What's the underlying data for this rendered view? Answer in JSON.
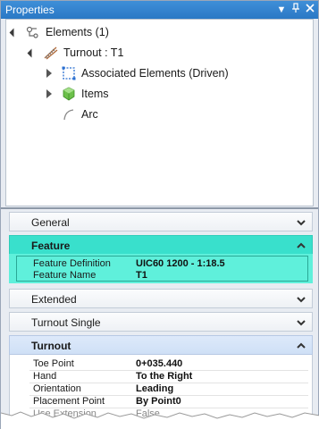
{
  "window": {
    "title": "Properties"
  },
  "titlebar_icons": [
    "dropdown-arrow-icon",
    "pin-icon",
    "close-icon"
  ],
  "tree": {
    "root_label": "Elements (1)",
    "turnout_label": "Turnout : T1",
    "children": [
      {
        "label": "Associated Elements (Driven)",
        "icon": "associated-elements-icon",
        "expandable": true
      },
      {
        "label": "Items",
        "icon": "items-cube-icon",
        "expandable": true
      },
      {
        "label": "Arc",
        "icon": "arc-icon",
        "expandable": false
      }
    ]
  },
  "sections": {
    "general": {
      "label": "General",
      "expanded": false
    },
    "feature": {
      "label": "Feature",
      "expanded": true,
      "rows": [
        {
          "name": "Feature Definition",
          "value": "UIC60 1200 - 1:18.5"
        },
        {
          "name": "Feature Name",
          "value": "T1"
        }
      ]
    },
    "extended": {
      "label": "Extended",
      "expanded": false
    },
    "turnout_single": {
      "label": "Turnout Single",
      "expanded": false
    },
    "turnout": {
      "label": "Turnout",
      "expanded": true,
      "rows": [
        {
          "name": "Toe Point",
          "value": "0+035.440"
        },
        {
          "name": "Hand",
          "value": "To the Right"
        },
        {
          "name": "Orientation",
          "value": "Leading"
        },
        {
          "name": "Placement Point",
          "value": "By Point0"
        },
        {
          "name": "Use Extension",
          "value": "False"
        }
      ]
    }
  },
  "colors": {
    "titlebar": "#2a78c5",
    "feature_highlight": "#39e0cc",
    "feature_body": "#5ff0db",
    "turnout_header": "#cfe0f6"
  }
}
